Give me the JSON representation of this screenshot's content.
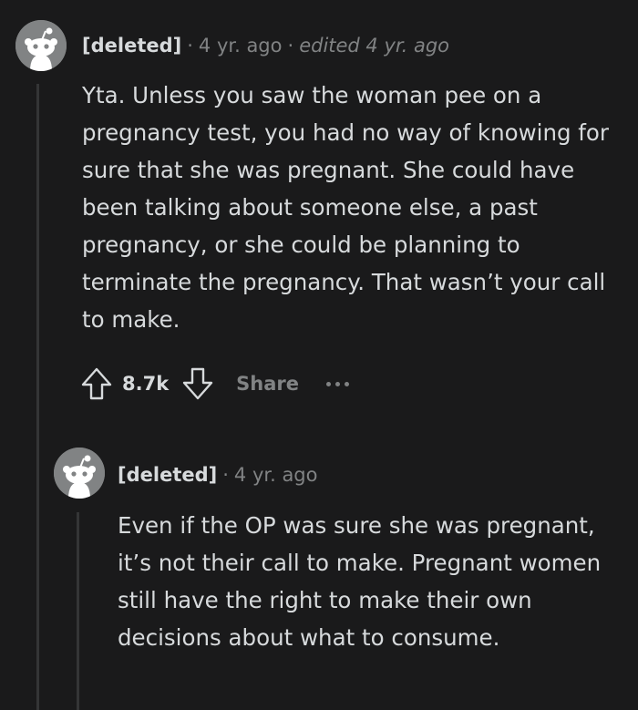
{
  "comments": [
    {
      "author": "[deleted]",
      "age": "4 yr. ago",
      "edited": "edited 4 yr. ago",
      "avatar_icon": "snoo-avatar-icon",
      "text": "Yta. Unless you saw the woman pee on a pregnancy test, you had no way of knowing for sure that she was pregnant. She could have been talking about someone else, a past pregnancy, or she could be planning to terminate the pregnancy. That wasn’t your call to make.",
      "score": "8.7k",
      "share_label": "Share"
    },
    {
      "author": "[deleted]",
      "age": "4 yr. ago",
      "avatar_icon": "snoo-avatar-icon",
      "text": "Even if the OP was sure she was pregnant, it’s not their call to make. Pregnant women still have the right to make their own decisions about what to consume."
    }
  ],
  "colors": {
    "background": "#1a1a1b",
    "text": "#d7dadc",
    "muted": "#818384",
    "thread_line": "#343536"
  }
}
